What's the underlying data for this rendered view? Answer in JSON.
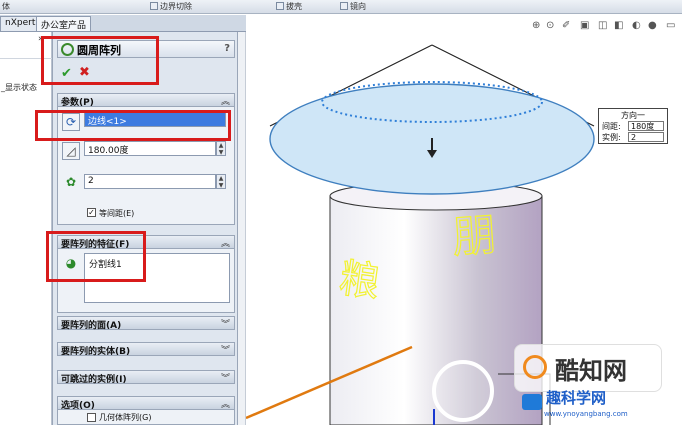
{
  "toolbar": {
    "item1": "体",
    "item2": "边界切除",
    "item3": "拔壳",
    "item4": "镜向"
  },
  "tabs": [
    {
      "label": "nXpert"
    },
    {
      "label": "办公室产品"
    }
  ],
  "tree": {
    "collapse_glyph": "»",
    "display_row": "_显示状态"
  },
  "feature": {
    "title": "圆周阵列",
    "help": "?",
    "ok_glyph": "✔",
    "cancel_glyph": "✖"
  },
  "params": {
    "header": "参数(P)",
    "axis_value": "边线<1>",
    "angle_value": "180.00度",
    "count_value": "2",
    "equal_spacing_label": "等间距(E)",
    "equal_spacing_checked": true
  },
  "features_group": {
    "header": "要阵列的特征(F)",
    "items": [
      "分割线1"
    ]
  },
  "collapsed_groups": [
    {
      "label": "要阵列的面(A)"
    },
    {
      "label": "要阵列的实体(B)"
    },
    {
      "label": "可跳过的实例(I)"
    }
  ],
  "options": {
    "header": "选项(O)",
    "geometry_pattern_label": "几何体阵列(G)"
  },
  "callout": {
    "title": "方向一",
    "spacing_label": "间距:",
    "spacing_value": "180度",
    "instances_label": "实例:",
    "instances_value": "2"
  },
  "model": {
    "text_left": "粮",
    "text_right": "朋"
  },
  "watermark": {
    "brand": "酷知网",
    "site_title": "趣科学网",
    "url": "www.ynoyangbang.com"
  },
  "colors": {
    "accent_red": "#d81b1b",
    "selection_blue": "#3d7be0",
    "model_text_yellow": "#ffff33",
    "edge_orange": "#e07a10"
  }
}
